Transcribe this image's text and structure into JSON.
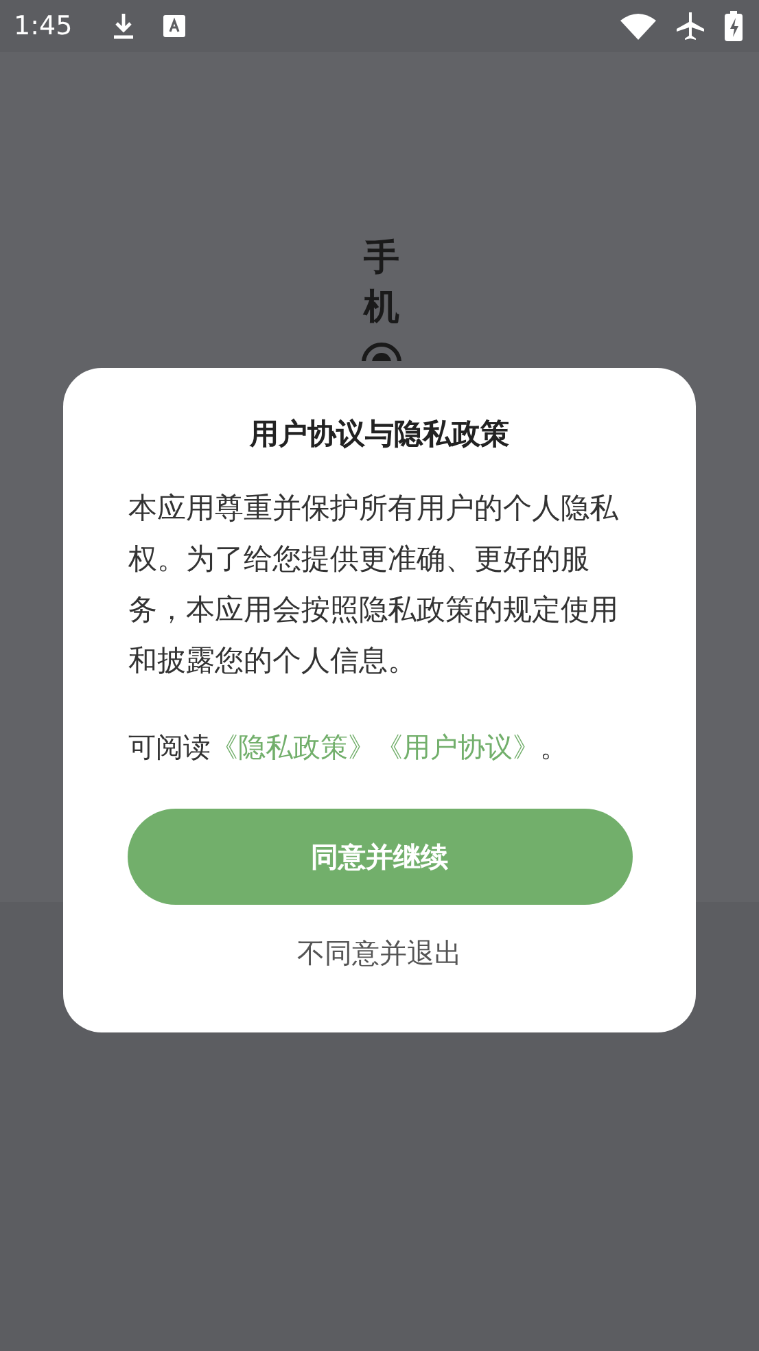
{
  "status_bar": {
    "time": "1:45"
  },
  "splash": {
    "title": "手机"
  },
  "dialog": {
    "title": "用户协议与隐私政策",
    "body": "本应用尊重并保护所有用户的个人隐私权。为了给您提供更准确、更好的服务，本应用会按照隐私政策的规定使用和披露您的个人信息。",
    "policy_line": {
      "prefix": "可阅读",
      "links": [
        "《隐私政策》",
        "《用户协议》"
      ],
      "suffix": "。"
    },
    "buttons": [
      {
        "kind": "primary",
        "label": "同意并继续"
      },
      {
        "kind": "secondary",
        "label": "不同意并退出"
      }
    ]
  }
}
